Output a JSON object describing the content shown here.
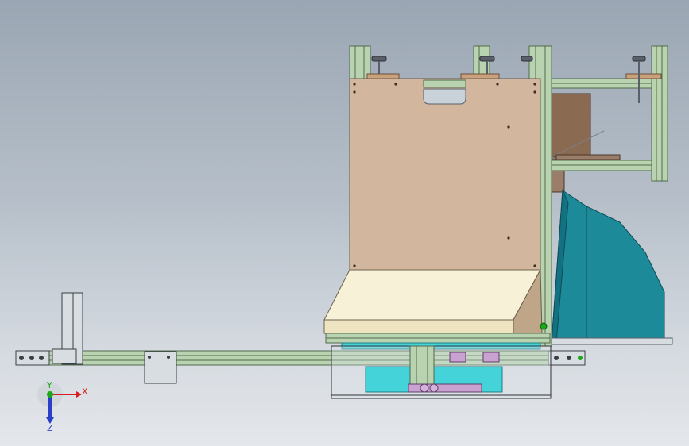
{
  "viewport": {
    "background_top": "#9aa6b3",
    "background_bottom": "#e4e7eb"
  },
  "colors": {
    "aluminum_profile": "#b9d3b1",
    "profile_edge": "#4f6a4c",
    "panel_beige": "#d2b79e",
    "panel_cream": "#f7f1d8",
    "hopper_teal": "#1d8a99",
    "cyan_part": "#43d3d9",
    "wood_brown": "#8b6a52",
    "purple_part": "#c9a2d2"
  },
  "triad": {
    "x_label": "X",
    "y_label": "Y",
    "z_label": "Z",
    "x_color": "#d81e1e",
    "y_color": "#1aa81a",
    "z_color": "#2a3fc8"
  }
}
